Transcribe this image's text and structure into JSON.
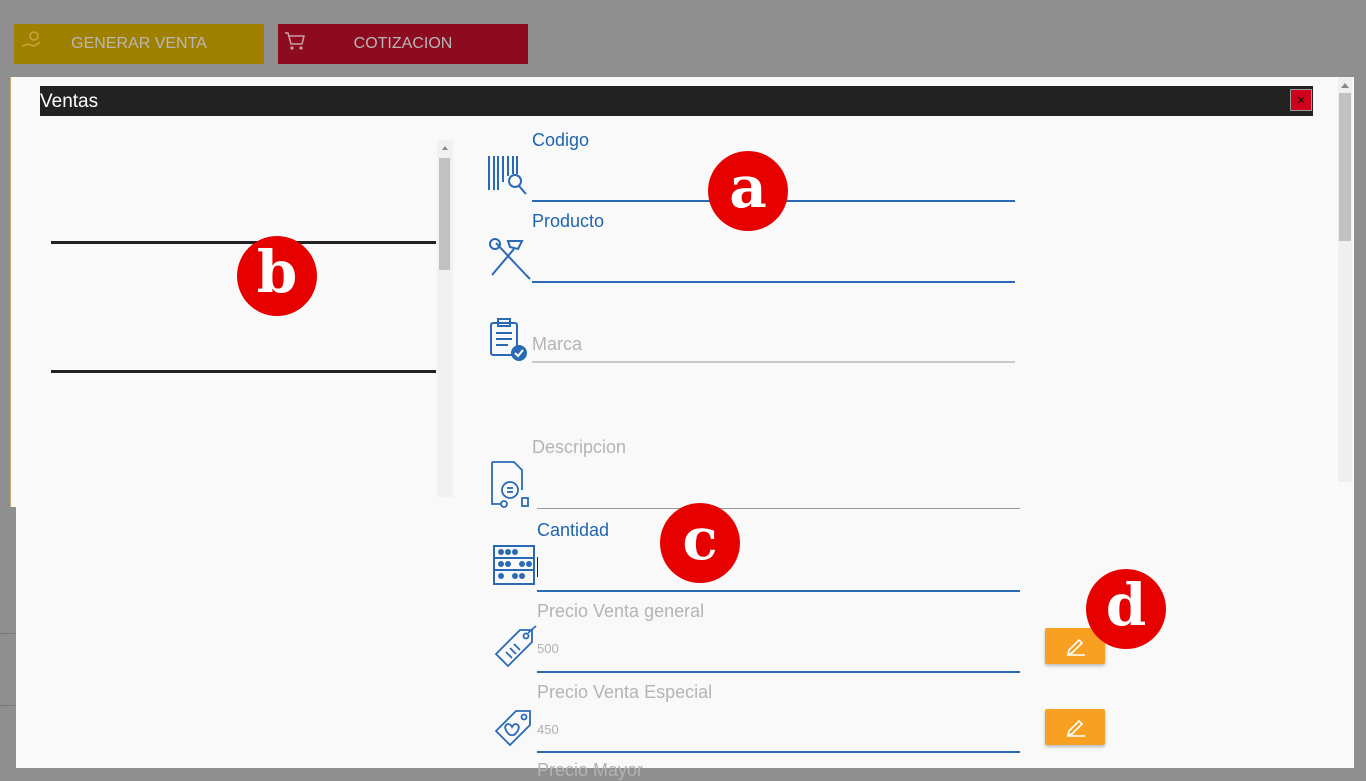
{
  "toolbar": {
    "generar_venta_label": "GENERAR VENTA",
    "cotizacion_label": "COTIZACION"
  },
  "modal": {
    "title": "Ventas",
    "close_glyph": "×"
  },
  "form": {
    "codigo_label": "Codigo",
    "producto_label": "Producto",
    "marca_label": "Marca",
    "descripcion_label": "Descripcion",
    "cantidad_label": "Cantidad",
    "precio_general_label": "Precio Venta general",
    "precio_general_value": "500",
    "precio_especial_label": "Precio Venta Especial",
    "precio_especial_value": "450",
    "precio_mayor_label": "Precio Mayor"
  },
  "badges": {
    "a": "a",
    "b": "b",
    "c": "c",
    "d": "d"
  },
  "colors": {
    "accent_blue": "#1f64b1",
    "edit_orange": "#f7a021",
    "badge_red": "#e60000",
    "titlebar": "#222222"
  },
  "icons": [
    "barcode-search-icon",
    "tools-icon",
    "clipboard-check-icon",
    "document-search-icon",
    "abacus-icon",
    "price-tag-icon",
    "tag-heart-icon",
    "pencil-icon",
    "cart-icon",
    "hand-money-icon"
  ]
}
